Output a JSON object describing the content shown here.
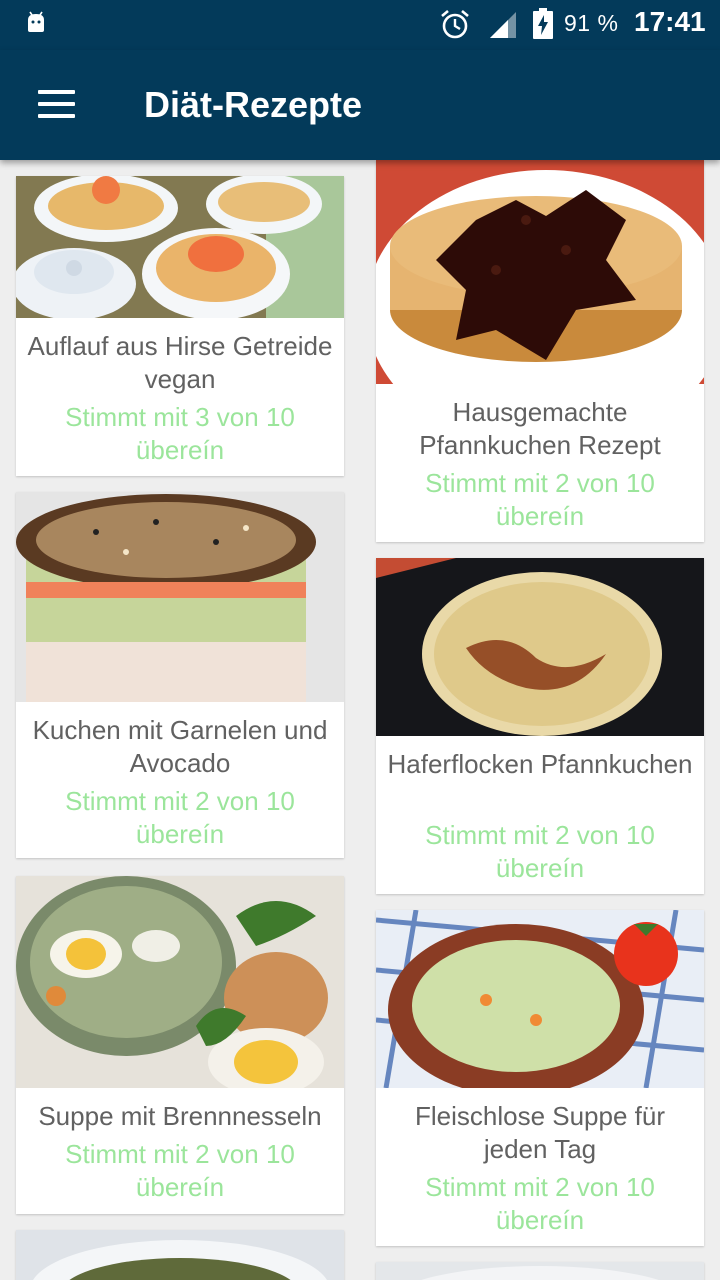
{
  "status_bar": {
    "battery": "91 %",
    "time": "17:41",
    "icons": [
      "android-icon",
      "alarm-icon",
      "signal-icon",
      "battery-charging-icon"
    ]
  },
  "app_bar": {
    "title": "Diät-Rezepte",
    "menu_icon": "hamburger-menu-icon"
  },
  "colors": {
    "primary": "#033a5a",
    "match_text": "#9be59b",
    "title_text": "#616161",
    "background": "#eeeeee"
  },
  "recipes": [
    {
      "title": "Auflauf aus Hirse Getreide vegan",
      "match": "Stimmt mit 3 von 10 übereín"
    },
    {
      "title": "Hausgemachte Pfannkuchen Rezept",
      "match": "Stimmt mit 2 von 10 übereín"
    },
    {
      "title": "Kuchen mit Garnelen und Avocado",
      "match": "Stimmt mit 2 von 10 übereín"
    },
    {
      "title": "Haferflocken Pfannkuchen",
      "match": "Stimmt mit 2 von 10 übereín"
    },
    {
      "title": "Suppe mit Brennnesseln",
      "match": "Stimmt mit 2 von 10 übereín"
    },
    {
      "title": "Fleischlose Suppe für jeden Tag",
      "match": "Stimmt mit 2 von 10 übereín"
    }
  ]
}
